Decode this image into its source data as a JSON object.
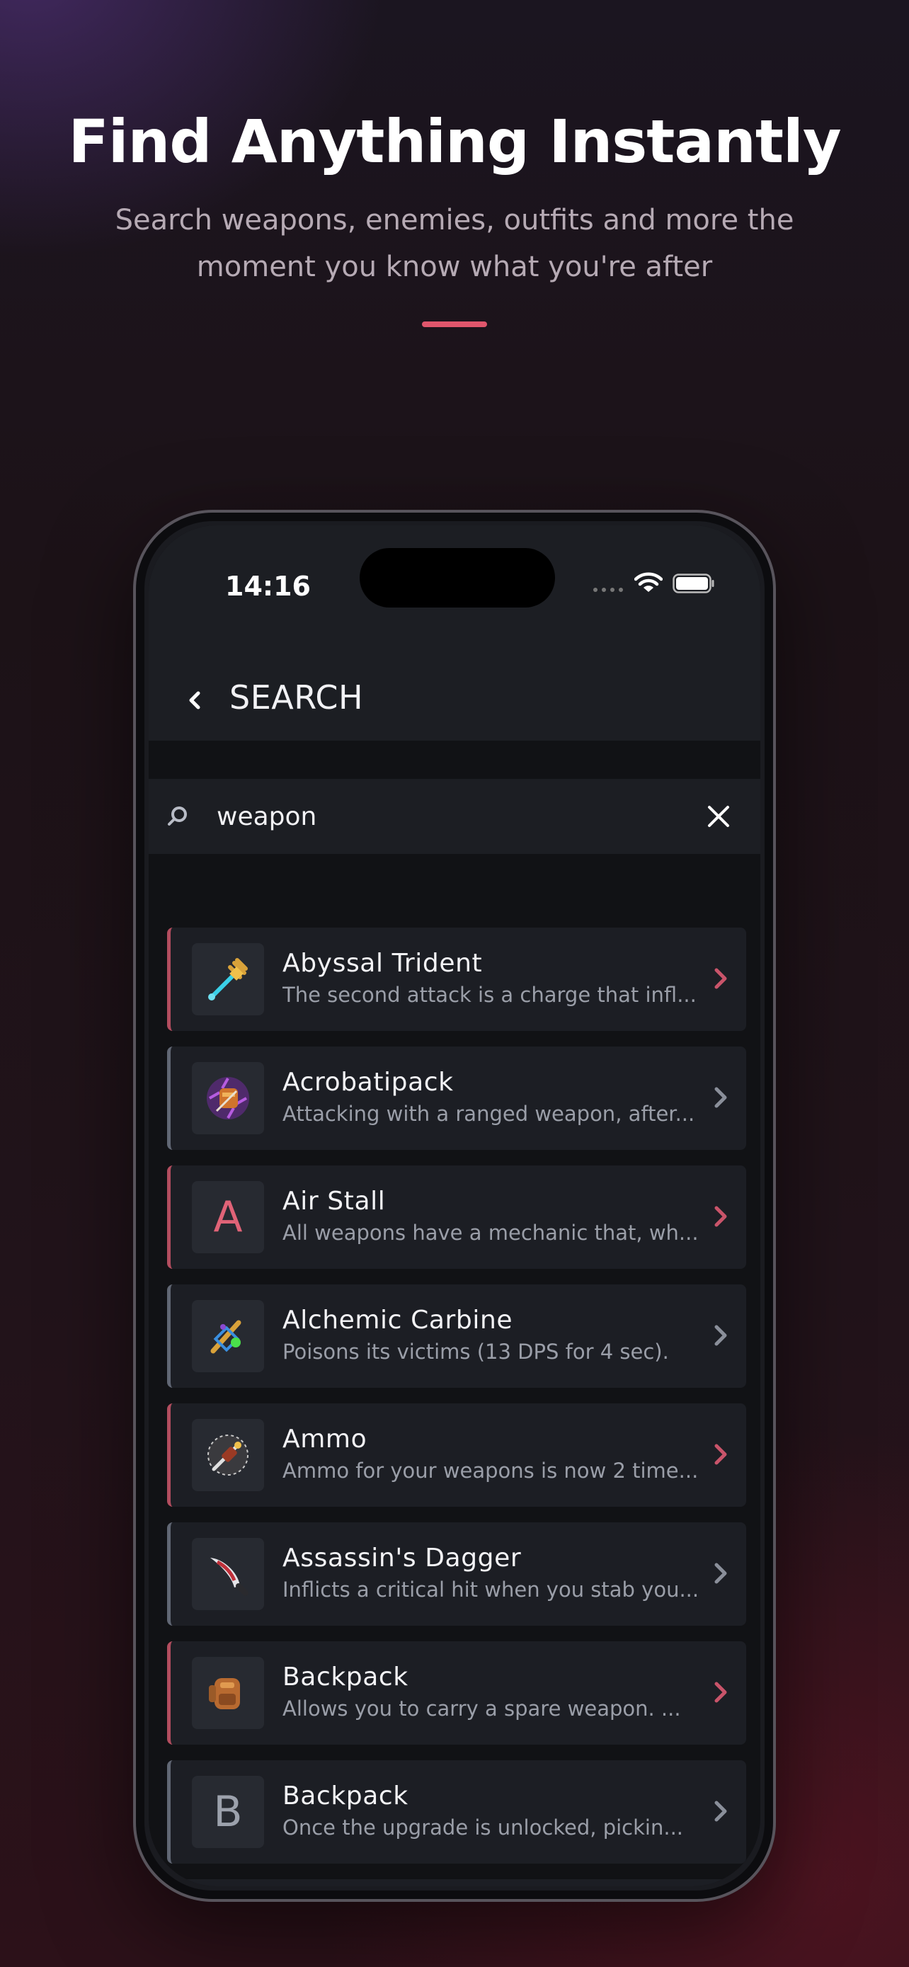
{
  "hero": {
    "title": "Find Anything Instantly",
    "subtitle": "Search weapons, enemies, outfits and more the moment you know what you're after"
  },
  "status_bar": {
    "time": "14:16"
  },
  "header": {
    "title": "SEARCH"
  },
  "search": {
    "value": "weapon",
    "placeholder": ""
  },
  "colors": {
    "accent": "#e0566c",
    "card": "#1c1e24",
    "accent_border": "#b34d5f",
    "neutral_border": "#616774"
  },
  "results": [
    {
      "title": "Abyssal Trident",
      "description": "The second attack is a charge that infl...",
      "icon": "trident-icon",
      "accent": true
    },
    {
      "title": "Acrobatipack",
      "description": "Attacking with a ranged weapon, after...",
      "icon": "backpack-purple-icon",
      "accent": false
    },
    {
      "title": "Air Stall",
      "description": "All weapons have a mechanic that, wh...",
      "letter": "A",
      "accent": true
    },
    {
      "title": "Alchemic Carbine",
      "description": "Poisons its victims (13 DPS for 4 sec).",
      "icon": "carbine-icon",
      "accent": false
    },
    {
      "title": "Ammo",
      "description": "Ammo for your weapons is now 2 time...",
      "icon": "ammo-icon",
      "accent": true
    },
    {
      "title": "Assassin's Dagger",
      "description": "Inflicts a critical hit when you stab you...",
      "icon": "dagger-icon",
      "accent": false
    },
    {
      "title": "Backpack",
      "description": "Allows you to carry a spare weapon. ...",
      "icon": "backpack-icon",
      "accent": true
    },
    {
      "title": "Backpack",
      "description": "Once the upgrade is unlocked, pickin...",
      "letter": "B",
      "accent": false
    }
  ]
}
